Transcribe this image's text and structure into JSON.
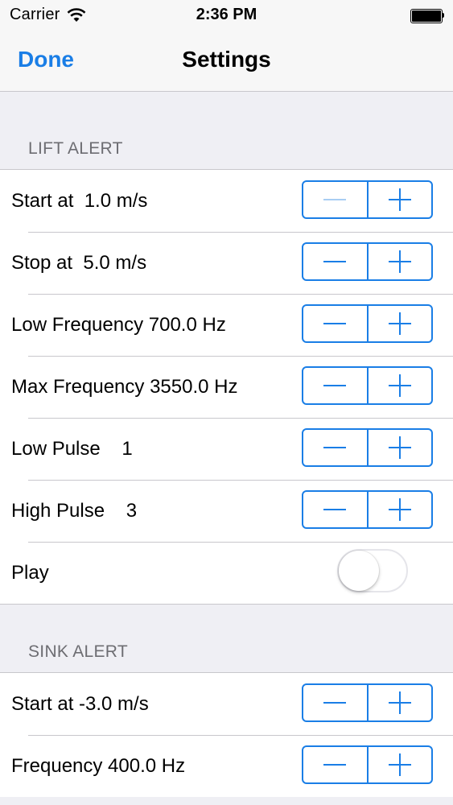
{
  "status_bar": {
    "carrier": "Carrier",
    "time": "2:36 PM",
    "battery_level": 1.0
  },
  "nav": {
    "done_label": "Done",
    "title": "Settings"
  },
  "lift_alert": {
    "header": "LIFT ALERT",
    "rows": [
      {
        "label": "Start at  1.0 m/s",
        "minus_enabled": false
      },
      {
        "label": "Stop at  5.0 m/s",
        "minus_enabled": true
      },
      {
        "label": "Low Frequency 700.0 Hz",
        "minus_enabled": true
      },
      {
        "label": "Max Frequency 3550.0 Hz",
        "minus_enabled": true
      },
      {
        "label": "Low Pulse    1",
        "minus_enabled": true
      },
      {
        "label": "High Pulse    3",
        "minus_enabled": true
      }
    ],
    "play_label": "Play",
    "play_on": false
  },
  "sink_alert": {
    "header": "SINK ALERT",
    "rows": [
      {
        "label": "Start at -3.0 m/s",
        "minus_enabled": true
      },
      {
        "label": "Frequency 400.0 Hz",
        "minus_enabled": true
      }
    ]
  },
  "colors": {
    "accent": "#1a7ee6",
    "background": "#efeff4",
    "separator": "#c8c7cc",
    "section_header": "#6d6d72"
  },
  "icons": {
    "wifi": "wifi-icon",
    "battery": "battery-icon",
    "minus": "minus-icon",
    "plus": "plus-icon"
  }
}
